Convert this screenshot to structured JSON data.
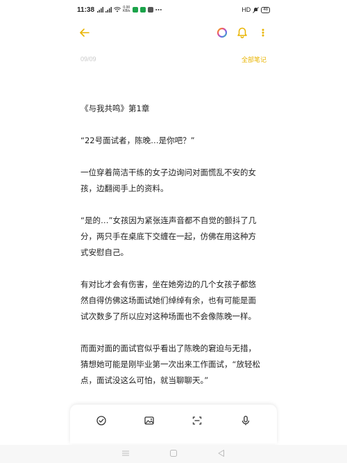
{
  "status_bar": {
    "time": "11:38",
    "net_speed_top": "0.00",
    "net_speed_bottom": "KB/s",
    "network": "HD",
    "battery": "48",
    "icons": [
      "signal-icon",
      "signal-icon",
      "wifi-icon",
      "net-speed-icon",
      "app-notify-icon",
      "app-notify-icon",
      "app-notify-icon",
      "more-dots-icon",
      "mute-icon",
      "battery-icon"
    ]
  },
  "toolbar": {
    "back_icon": "arrow-left-icon",
    "theme_icon": "color-ring-icon",
    "reminder_icon": "bell-icon",
    "more_icon": "more-vertical-icon"
  },
  "note": {
    "date": "09/09",
    "all_notes_link": "全部笔记",
    "title": "《与我共鸣》第1章",
    "paragraphs": [
      [
        "“22号面试者，陈晚…是你吧？”"
      ],
      [
        "一位穿着简洁干练的女子边询问对面慌乱不安的女",
        "孩，边翻阅手上的资料。"
      ],
      [
        "“是的…”女孩因为紧张连声音都不自觉的颤抖了几",
        "分，两只手在桌底下交缠在一起，仿佛在用这种方",
        "式安慰自己。"
      ],
      [
        "有对比才会有伤害，坐在她旁边的几个女孩子都悠",
        "然自得仿佛这场面试她们绰绰有余，也有可能是面",
        "试次数多了所以应对这种场面也不会像陈晚一样。"
      ],
      [
        "而面对面的面试官似乎看出了陈晚的窘迫与无措，",
        "猜想她可能是刚毕业第一次出来工作面试，“放轻松",
        "点，面试没这么可怕，就当聊聊天。”"
      ]
    ]
  },
  "bottom_tools": [
    "checklist-icon",
    "image-icon",
    "scan-icon",
    "microphone-icon"
  ],
  "nav_bar": [
    "menu-icon",
    "home-icon",
    "back-triangle-icon"
  ],
  "colors": {
    "accent": "#e9b400",
    "text": "#222222",
    "date": "#c8c8c8"
  }
}
